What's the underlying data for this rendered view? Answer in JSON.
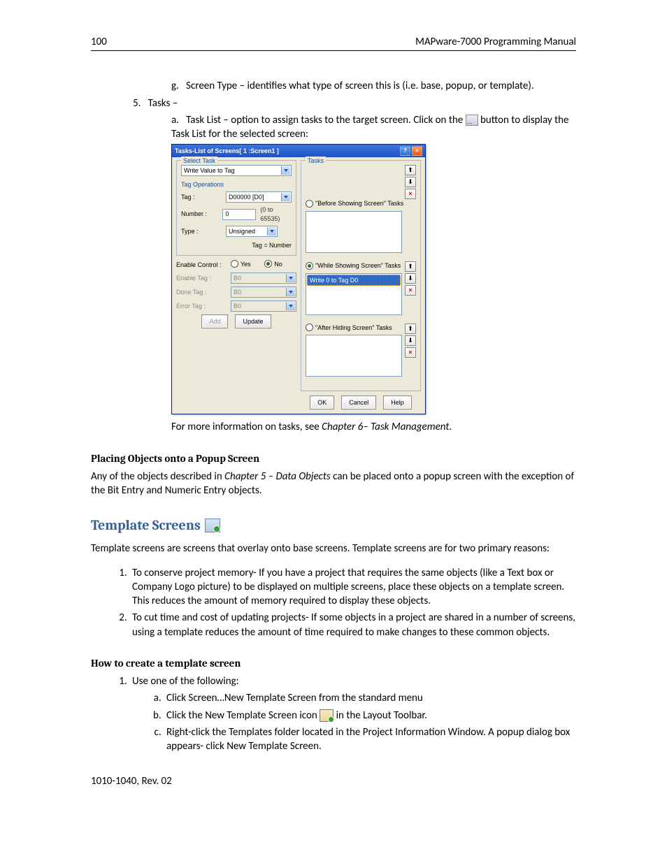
{
  "header": {
    "page": "100",
    "title": "MAPware-7000 Programming Manual"
  },
  "list_g": {
    "marker": "g.",
    "text": "Screen Type – identifies what type of screen this is (i.e. base, popup, or template)."
  },
  "list_5": {
    "marker": "5.",
    "text": "Tasks –"
  },
  "list_a": {
    "marker": "a.",
    "text_before": "Task List – option to assign tasks to the target screen. Click on the ",
    "text_after": "button to display the Task List for the selected screen:"
  },
  "dialog": {
    "title": "Tasks-List of Screens[ 1 :Screen1 ]",
    "help_btn": "?",
    "close_btn": "×",
    "select_task_legend": "Select Task",
    "select_task_value": "Write Value to Tag",
    "tag_ops_legend": "Tag Operations",
    "tag_label": "Tag :",
    "tag_value": "D00000 [D0]",
    "number_label": "Number :",
    "number_value": "0",
    "number_hint": "(0 to 65535)",
    "type_label": "Type :",
    "type_value": "Unsigned",
    "tag_equals": "Tag = Number",
    "enable_control_label": "Enable Control :",
    "yes": "Yes",
    "no": "No",
    "enable_tag_label": "Enable Tag :",
    "enable_tag_value": "B0",
    "done_tag_label": "Done Tag :",
    "done_tag_value": "B0",
    "error_tag_label": "Error Tag :",
    "error_tag_value": "B0",
    "add_btn": "Add",
    "update_btn": "Update",
    "tasks_legend": "Tasks",
    "radio_before": "\"Before Showing Screen\" Tasks",
    "radio_while": "\"While Showing Screen\" Tasks",
    "radio_after": "\"After Hiding Screen\" Tasks",
    "while_item": "Write 0 to Tag D0",
    "up": "⬆",
    "down": "⬇",
    "del": "×",
    "ok_btn": "OK",
    "cancel_btn": "Cancel",
    "help_btn_bottom": "Help"
  },
  "caption_below": {
    "pre": "For more information on tasks, see ",
    "italic": "Chapter 6– Task Management",
    "post": "."
  },
  "sec_popup": {
    "head": "Placing Objects onto a Popup Screen",
    "p_pre": "Any of the objects described in ",
    "p_italic": "Chapter 5 – Data Objects",
    "p_post": " can be placed onto a popup screen with the exception of the Bit Entry and Numeric Entry objects."
  },
  "sec_template": {
    "head": "Template Screens",
    "intro": "Template screens are screens that overlay onto base screens.  Template screens are for two primary reasons:",
    "li1": "To conserve project memory- If you have a project that requires the same objects (like a Text box or Company Logo picture) to be displayed on multiple screens, place these objects on a template screen.  This reduces the amount of memory required to display these objects.",
    "li2": "To cut time and cost of updating projects- If some objects in a project are shared in a number of screens, using a template reduces the amount of time required to make changes to these common objects."
  },
  "sec_howto": {
    "head": "How to create a template screen",
    "li1": "Use one of the following:",
    "a": "Click Screen…New Template Screen from the standard menu",
    "b_pre": "Click the New Template Screen icon ",
    "b_post": " in the Layout Toolbar.",
    "c": "Right-click the Templates folder located in the Project Information Window.  A popup dialog box appears- click New Template Screen."
  },
  "footer": "1010-1040, Rev. 02"
}
